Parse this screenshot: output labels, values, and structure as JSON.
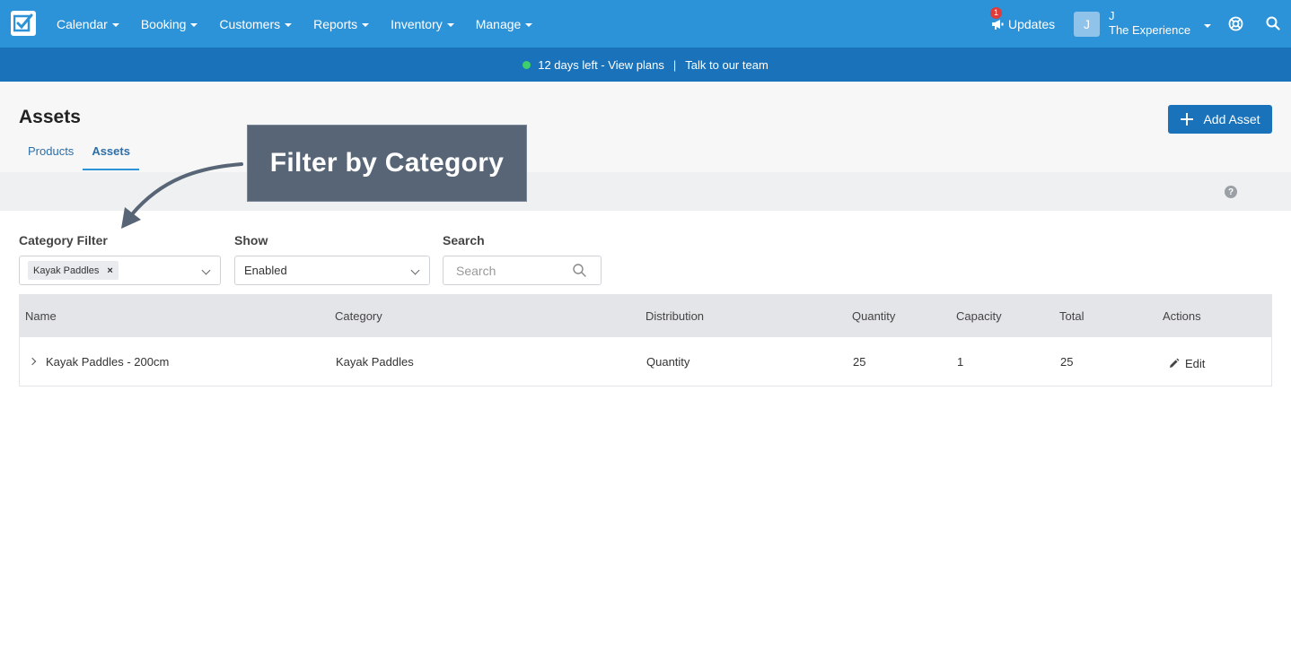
{
  "nav": {
    "items": [
      {
        "label": "Calendar"
      },
      {
        "label": "Booking"
      },
      {
        "label": "Customers"
      },
      {
        "label": "Reports"
      },
      {
        "label": "Inventory"
      },
      {
        "label": "Manage"
      }
    ],
    "updates_label": "Updates",
    "updates_badge": "1",
    "avatar_initial": "J",
    "user_name": "J",
    "company": "The Experience"
  },
  "trial": {
    "days_left": "12 days left - View plans",
    "separator": "|",
    "talk": "Talk to our team"
  },
  "header": {
    "title": "Assets",
    "tabs": [
      {
        "label": "Products",
        "active": false
      },
      {
        "label": "Assets",
        "active": true
      }
    ],
    "add_button": "Add Asset",
    "help": "?"
  },
  "callout": {
    "text": "Filter by Category"
  },
  "filters": {
    "category_label": "Category Filter",
    "category_chip": "Kayak Paddles",
    "chip_remove": "×",
    "show_label": "Show",
    "show_value": "Enabled",
    "search_label": "Search",
    "search_placeholder": "Search"
  },
  "table": {
    "columns": [
      "Name",
      "Category",
      "Distribution",
      "Quantity",
      "Capacity",
      "Total",
      "Actions"
    ],
    "rows": [
      {
        "name": "Kayak Paddles - 200cm",
        "category": "Kayak Paddles",
        "distribution": "Quantity",
        "quantity": "25",
        "capacity": "1",
        "total": "25",
        "action": "Edit"
      }
    ]
  },
  "colors": {
    "nav_bg": "#2d93d8",
    "trial_bg": "#1a73ba",
    "accent": "#1a73ba",
    "callout_bg": "#586576"
  }
}
